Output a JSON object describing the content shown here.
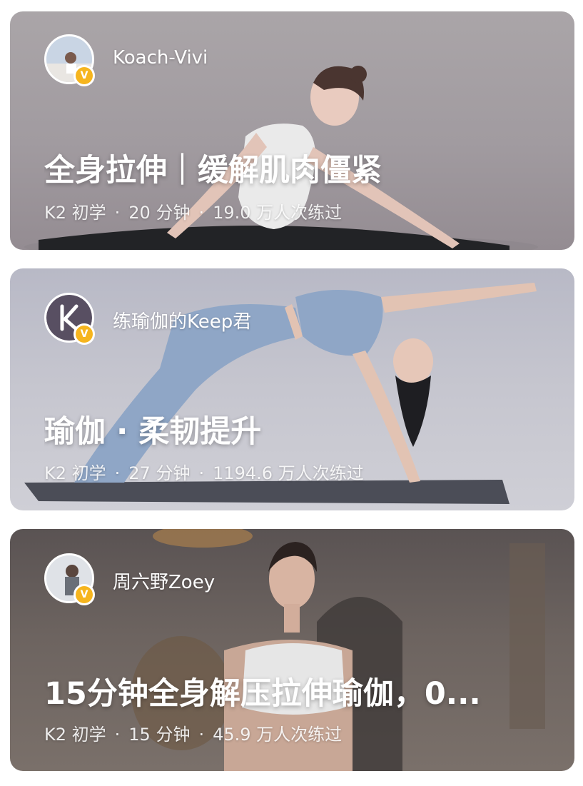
{
  "colors": {
    "badge": "#f6b51e",
    "text": "#ffffff"
  },
  "icons": {
    "badge": "v-verified-badge-icon"
  },
  "courses": [
    {
      "author": "Koach-Vivi",
      "badge": "V",
      "title": "全身拉伸｜缓解肌肉僵紧",
      "level": "K2 初学",
      "duration": "20 分钟",
      "participants": "19.0 万人次练过"
    },
    {
      "author": "练瑜伽的Keep君",
      "badge": "V",
      "title": "瑜伽 · 柔韧提升",
      "level": "K2 初学",
      "duration": "27 分钟",
      "participants": "1194.6 万人次练过"
    },
    {
      "author": "周六野Zoey",
      "badge": "V",
      "title": "15分钟全身解压拉伸瑜伽，0...",
      "level": "K2 初学",
      "duration": "15 分钟",
      "participants": "45.9 万人次练过"
    }
  ]
}
